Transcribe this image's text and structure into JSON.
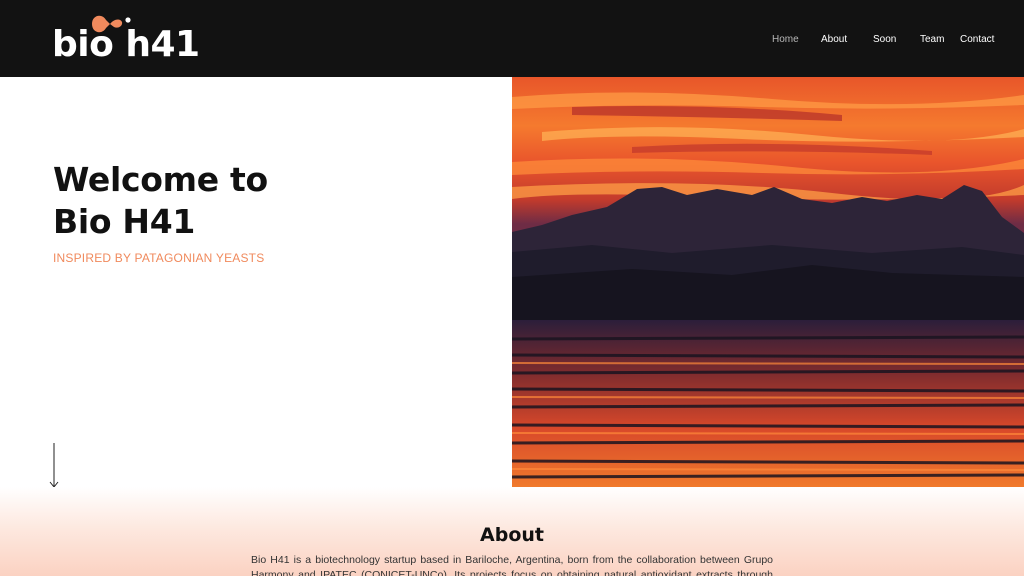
{
  "brand": {
    "name": "bio h41",
    "accent": "#f08a5d"
  },
  "nav": {
    "items": [
      {
        "label": "Home",
        "active": true
      },
      {
        "label": "About",
        "active": false
      },
      {
        "label": "Soon",
        "active": false
      },
      {
        "label": "Team",
        "active": false
      },
      {
        "label": "Contact",
        "active": false
      }
    ]
  },
  "hero": {
    "title_line1": "Welcome to",
    "title_line2": "Bio H41",
    "subtitle": "INSPIRED BY PATAGONIAN YEASTS",
    "scroll_icon": "arrow-down-icon",
    "image": "sunset-lake-mountains"
  },
  "about": {
    "title": "About",
    "text": "Bio H41 is a biotechnology startup based in Bariloche, Argentina, born from the collaboration between Grupo Harmony and IPATEC (CONICET-UNCo). Its projects focus on obtaining natural antioxidant extracts through precision"
  }
}
